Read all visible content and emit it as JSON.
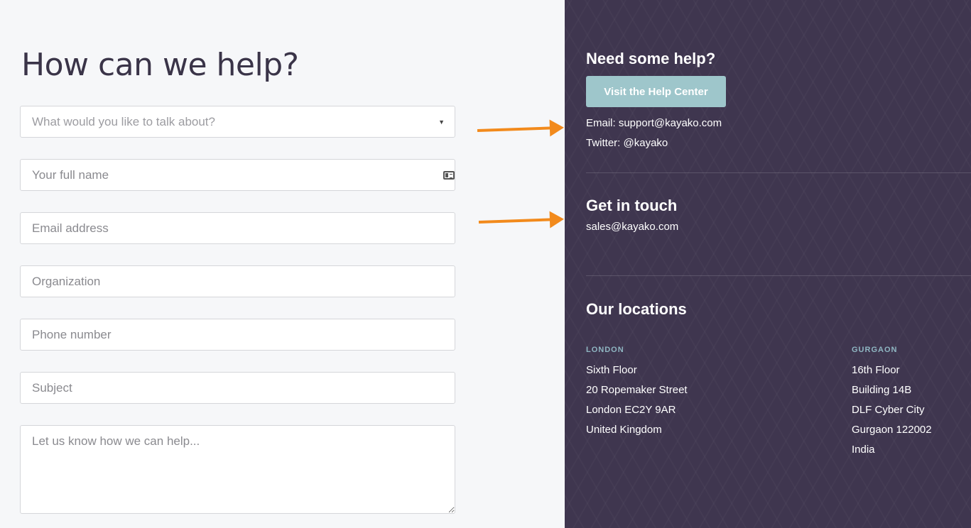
{
  "form": {
    "title": "How can we help?",
    "topic_placeholder": "What would you like to talk about?",
    "name_placeholder": "Your full name",
    "email_placeholder": "Email address",
    "organization_placeholder": "Organization",
    "phone_placeholder": "Phone number",
    "subject_placeholder": "Subject",
    "message_placeholder": "Let us know how we can help..."
  },
  "sidebar": {
    "help": {
      "heading": "Need some help?",
      "button_label": "Visit the Help Center",
      "email_line": "Email: support@kayako.com",
      "twitter_line": "Twitter: @kayako"
    },
    "contact": {
      "heading": "Get in touch",
      "sales_email": "sales@kayako.com"
    },
    "locations": {
      "heading": "Our locations",
      "offices": [
        {
          "name": "LONDON",
          "lines": [
            "Sixth Floor",
            "20 Ropemaker Street",
            "London EC2Y 9AR",
            "United Kingdom"
          ]
        },
        {
          "name": "GURGAON",
          "lines": [
            "16th Floor",
            "Building 14B",
            "DLF Cyber City",
            "Gurgaon 122002",
            "India"
          ]
        }
      ]
    }
  },
  "colors": {
    "sidebar_bg": "#3f364f",
    "button_bg": "#9ec6cb",
    "arrow": "#f28a1c",
    "location_label": "#8fb6c2"
  },
  "icons": [
    "chevron-down-icon",
    "id-card-icon",
    "arrow-annotation"
  ]
}
